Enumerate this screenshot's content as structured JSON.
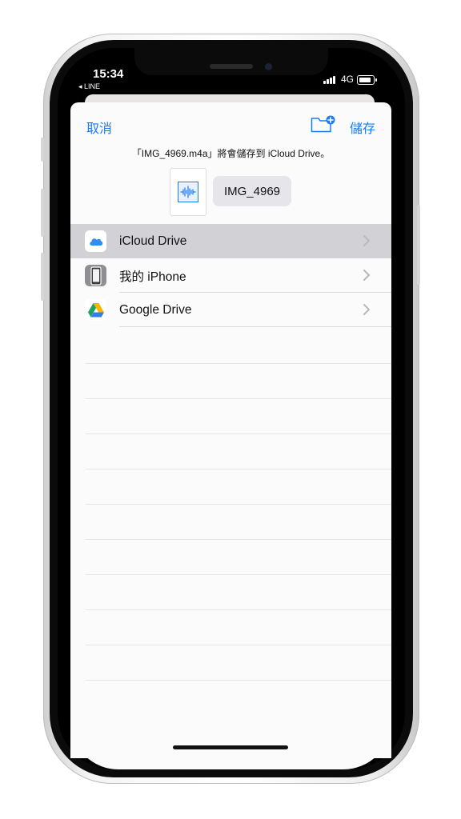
{
  "status_bar": {
    "time": "15:34",
    "back_app": "◂ LINE",
    "network": "4G"
  },
  "nav": {
    "cancel_label": "取消",
    "save_label": "儲存",
    "new_folder_icon": "folder-plus-icon"
  },
  "message": "「IMG_4969.m4a」將會儲存到 iCloud Drive。",
  "file": {
    "thumbnail_icon": "audio-waveform-icon",
    "name": "IMG_4969"
  },
  "locations": [
    {
      "label": "iCloud Drive",
      "icon": "icloud-icon",
      "selected": true
    },
    {
      "label": "我的 iPhone",
      "icon": "iphone-icon",
      "selected": false
    },
    {
      "label": "Google Drive",
      "icon": "google-drive-icon",
      "selected": false
    }
  ],
  "colors": {
    "accent": "#1a7cf5",
    "selected_row": "#d1d1d6",
    "sheet_bg": "#fbfbfb"
  }
}
